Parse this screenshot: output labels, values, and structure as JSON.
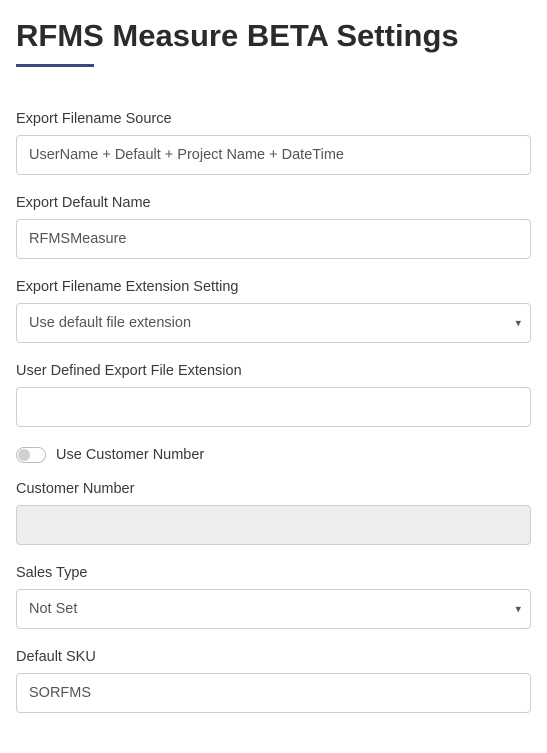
{
  "title": "RFMS Measure BETA Settings",
  "fields": {
    "export_filename_source": {
      "label": "Export Filename Source",
      "value": "UserName + Default + Project Name + DateTime"
    },
    "export_default_name": {
      "label": "Export Default Name",
      "value": "RFMSMeasure"
    },
    "export_ext_setting": {
      "label": "Export Filename Extension Setting",
      "selected": "Use default file extension"
    },
    "user_defined_ext": {
      "label": "User Defined Export File Extension",
      "value": ""
    },
    "use_customer_number": {
      "label": "Use Customer Number",
      "on": false
    },
    "customer_number": {
      "label": "Customer Number",
      "value": ""
    },
    "sales_type": {
      "label": "Sales Type",
      "selected": "Not Set"
    },
    "default_sku": {
      "label": "Default SKU",
      "value": "SORFMS"
    }
  }
}
